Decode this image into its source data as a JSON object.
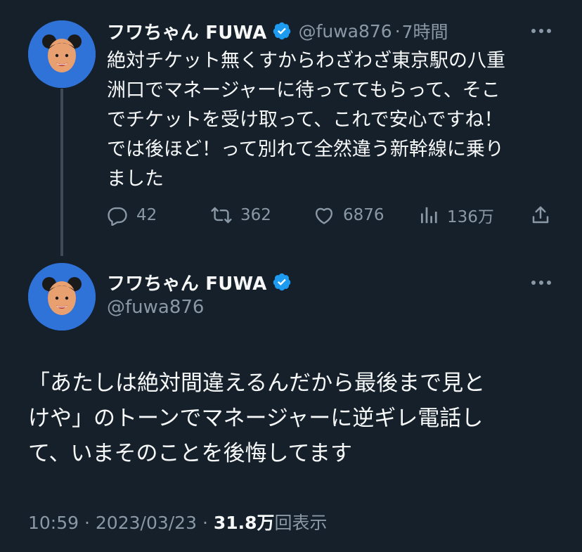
{
  "tweet_1": {
    "display_name": "フワちゃん FUWA",
    "handle": "@fuwa876",
    "separator": "·",
    "time": "7時間",
    "text_lines": [
      "絶対チケット無くすからわざわざ東京駅の八重",
      "洲口でマネージャーに待っててもらって、そこ",
      "でチケットを受け取って、これで安心ですね！",
      "では後ほど！って別れて全然違う新幹線に乗り",
      "ました"
    ],
    "replies": "42",
    "retweets": "362",
    "likes": "6876",
    "views": "136万"
  },
  "tweet_2": {
    "display_name": "フワちゃん FUWA",
    "handle": "@fuwa876",
    "text_lines": [
      "「あたしは絶対間違えるんだから最後まで見と",
      "けや」のトーンでマネージャーに逆ギレ電話し",
      "て、いまそのことを後悔してます"
    ],
    "time": "10:59",
    "date": "2023/03/23",
    "separator": "·",
    "views_count": "31.8万",
    "views_label": "回表示"
  },
  "colors": {
    "background": "#15202b",
    "text": "#f7f9f9",
    "secondary": "#8b98a5",
    "verified": "#1d9bf0",
    "avatar_bg": "#2f73d8"
  },
  "icons": {
    "verified": "verified-badge-icon",
    "more": "more-dots-icon",
    "reply": "reply-bubble-icon",
    "retweet": "retweet-arrows-icon",
    "like": "heart-icon",
    "views": "bar-chart-icon",
    "share": "share-upload-icon"
  }
}
